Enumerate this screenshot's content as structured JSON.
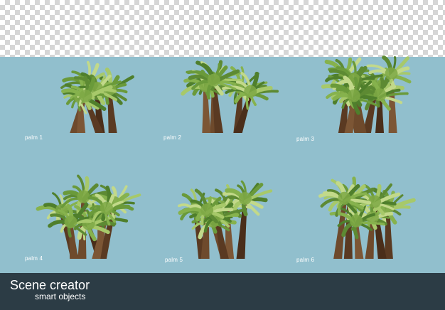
{
  "background": {
    "transparent_area": "checkerboard",
    "scene_color": "#91bfcd",
    "footer_color": "#2c3c45"
  },
  "palms": [
    {
      "label": "palm 1",
      "variant": 0
    },
    {
      "label": "palm 2",
      "variant": 1
    },
    {
      "label": "palm 3",
      "variant": 2
    },
    {
      "label": "palm 4",
      "variant": 3
    },
    {
      "label": "palm 5",
      "variant": 4
    },
    {
      "label": "palm 6",
      "variant": 5
    }
  ],
  "footer": {
    "title": "Scene creator",
    "subtitle": "smart objects"
  }
}
